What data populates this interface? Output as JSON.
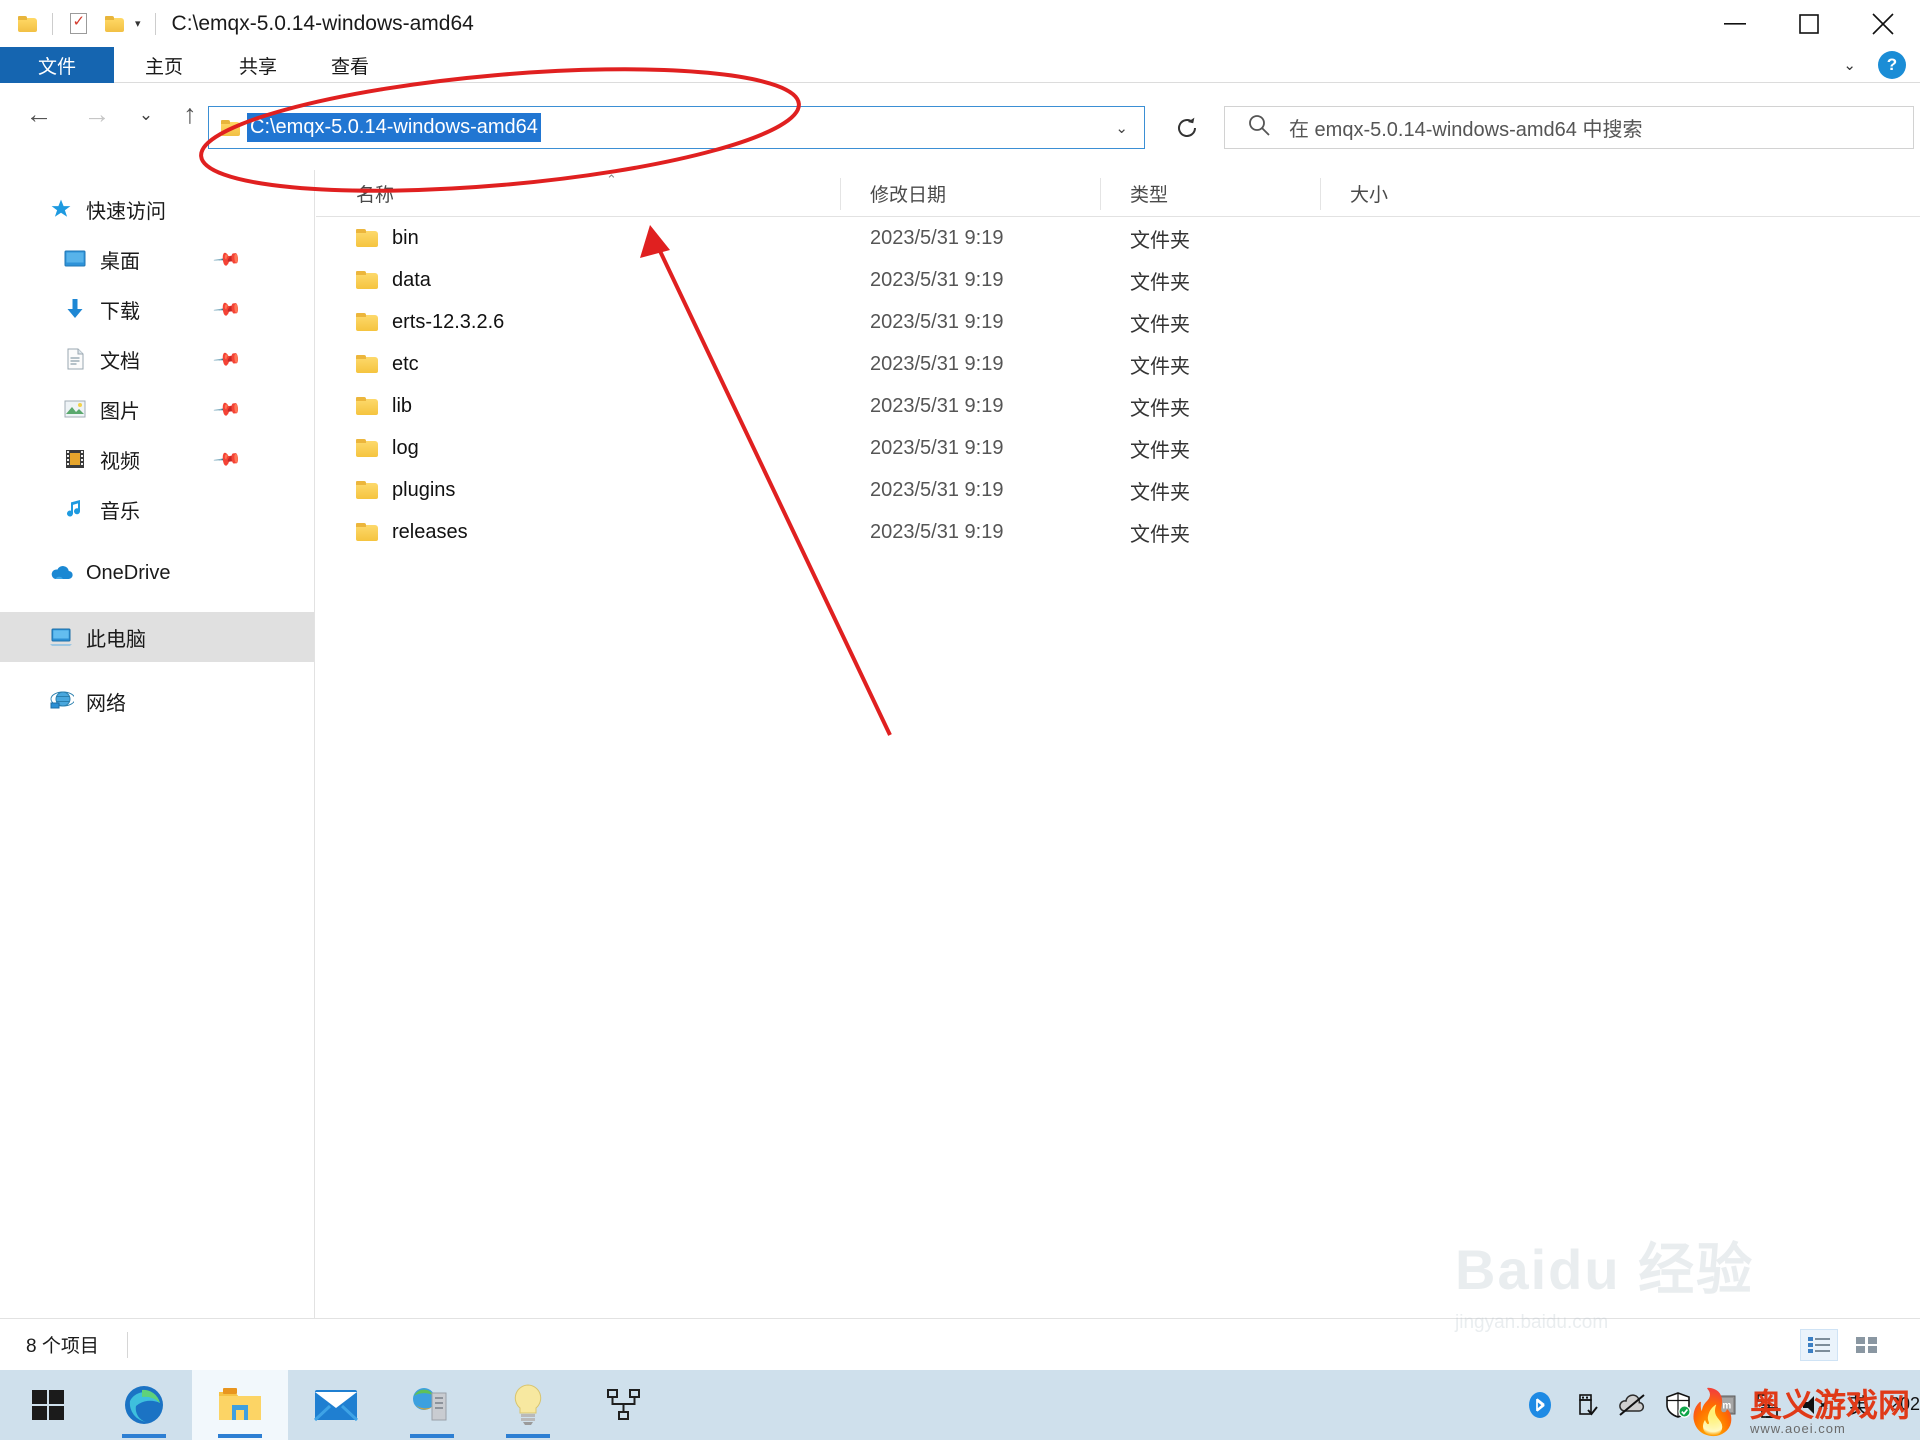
{
  "window": {
    "title": "C:\\emqx-5.0.14-windows-amd64",
    "quick_access": [
      {
        "name": "folder-icon",
        "label": "文件夹"
      },
      {
        "name": "properties-icon",
        "label": "属性"
      },
      {
        "name": "new-folder-icon",
        "label": "新建文件夹"
      },
      {
        "name": "chevron-down-icon",
        "label": "▾"
      }
    ],
    "controls": {
      "minimize": "—",
      "maximize": "❐",
      "close": "✕"
    }
  },
  "ribbon": {
    "tabs": [
      {
        "id": "file",
        "label": "文件",
        "active": true
      },
      {
        "id": "home",
        "label": "主页",
        "active": false
      },
      {
        "id": "share",
        "label": "共享",
        "active": false
      },
      {
        "id": "view",
        "label": "查看",
        "active": false
      }
    ],
    "expand_label": "⌄",
    "help_label": "?"
  },
  "navigation": {
    "back_label": "←",
    "forward_label": "→",
    "recent_label": "⌄",
    "up_label": "↑"
  },
  "address": {
    "value": "C:\\emqx-5.0.14-windows-amd64",
    "dropdown_label": "⌄",
    "refresh_label": "↻"
  },
  "search": {
    "placeholder": "在 emqx-5.0.14-windows-amd64 中搜索"
  },
  "sidebar": {
    "items": [
      {
        "label": "快速访问",
        "icon": "star-icon",
        "level": "root",
        "pinned": false,
        "selected": false
      },
      {
        "label": "桌面",
        "icon": "desktop-icon",
        "level": "child",
        "pinned": true,
        "selected": false
      },
      {
        "label": "下载",
        "icon": "download-icon",
        "level": "child",
        "pinned": true,
        "selected": false
      },
      {
        "label": "文档",
        "icon": "document-icon",
        "level": "child",
        "pinned": true,
        "selected": false
      },
      {
        "label": "图片",
        "icon": "picture-icon",
        "level": "child",
        "pinned": true,
        "selected": false
      },
      {
        "label": "视频",
        "icon": "video-icon",
        "level": "child",
        "pinned": true,
        "selected": false
      },
      {
        "label": "音乐",
        "icon": "music-icon",
        "level": "child",
        "pinned": false,
        "selected": false
      },
      {
        "label": "OneDrive",
        "icon": "onedrive-icon",
        "level": "root",
        "pinned": false,
        "selected": false
      },
      {
        "label": "此电脑",
        "icon": "this-pc-icon",
        "level": "root",
        "pinned": false,
        "selected": true
      },
      {
        "label": "网络",
        "icon": "network-icon",
        "level": "root",
        "pinned": false,
        "selected": false
      }
    ]
  },
  "filelist": {
    "columns": [
      {
        "id": "name",
        "label": "名称"
      },
      {
        "id": "date",
        "label": "修改日期"
      },
      {
        "id": "type",
        "label": "类型"
      },
      {
        "id": "size",
        "label": "大小"
      }
    ],
    "sort_indicator": "⌃",
    "rows": [
      {
        "name": "bin",
        "date": "2023/5/31 9:19",
        "type": "文件夹",
        "size": ""
      },
      {
        "name": "data",
        "date": "2023/5/31 9:19",
        "type": "文件夹",
        "size": ""
      },
      {
        "name": "erts-12.3.2.6",
        "date": "2023/5/31 9:19",
        "type": "文件夹",
        "size": ""
      },
      {
        "name": "etc",
        "date": "2023/5/31 9:19",
        "type": "文件夹",
        "size": ""
      },
      {
        "name": "lib",
        "date": "2023/5/31 9:19",
        "type": "文件夹",
        "size": ""
      },
      {
        "name": "log",
        "date": "2023/5/31 9:19",
        "type": "文件夹",
        "size": ""
      },
      {
        "name": "plugins",
        "date": "2023/5/31 9:19",
        "type": "文件夹",
        "size": ""
      },
      {
        "name": "releases",
        "date": "2023/5/31 9:19",
        "type": "文件夹",
        "size": ""
      }
    ]
  },
  "statusbar": {
    "item_count": "8 个项目",
    "view_details_label": "详细信息",
    "view_large_label": "大图标"
  },
  "taskbar": {
    "apps": [
      {
        "name": "start-button",
        "label": "开始",
        "active": false,
        "running": false
      },
      {
        "name": "edge-icon",
        "label": "Microsoft Edge",
        "active": false,
        "running": true
      },
      {
        "name": "file-explorer-icon",
        "label": "文件资源管理器",
        "active": true,
        "running": true
      },
      {
        "name": "mail-icon",
        "label": "邮件",
        "active": false,
        "running": false
      },
      {
        "name": "iis-manager-icon",
        "label": "IIS 管理器",
        "active": false,
        "running": true
      },
      {
        "name": "idea-icon",
        "label": "提示",
        "active": false,
        "running": true
      },
      {
        "name": "network-tool-icon",
        "label": "网络工具",
        "active": false,
        "running": false
      }
    ],
    "tray": [
      {
        "name": "bluetooth-icon",
        "label": "蓝牙"
      },
      {
        "name": "usb-eject-icon",
        "label": "安全删除硬件"
      },
      {
        "name": "onedrive-offline-icon",
        "label": "OneDrive 脱机"
      },
      {
        "name": "defender-shield-icon",
        "label": "Windows 安全中心"
      },
      {
        "name": "vmware-icon",
        "label": "VMware"
      },
      {
        "name": "network-icon",
        "label": "网络"
      },
      {
        "name": "volume-muted-icon",
        "label": "音量 已静音"
      }
    ],
    "ime_label": "英",
    "clock_text": "202"
  },
  "annotations": {
    "ellipse_color": "#e02020",
    "arrow_color": "#e02020"
  },
  "watermark": {
    "baidu_main": "Baidu 经验",
    "baidu_sub": "jingyan.baidu.com",
    "logo_main": "奥义游戏网",
    "logo_sub": "www.aoei.com"
  }
}
